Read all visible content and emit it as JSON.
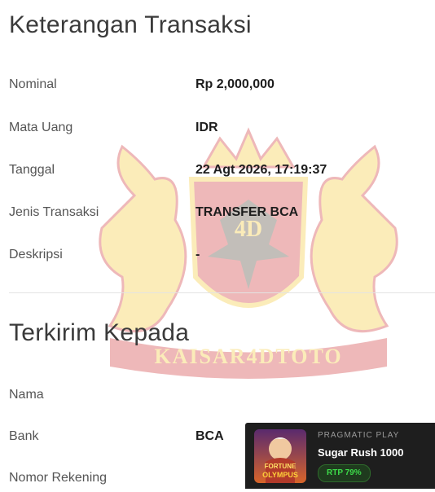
{
  "transaction": {
    "title": "Keterangan Transaksi",
    "rows": [
      {
        "label": "Nominal",
        "value": "Rp 2,000,000"
      },
      {
        "label": "Mata Uang",
        "value": "IDR"
      },
      {
        "label": "Tanggal",
        "value": "22 Agt 2026, 17:19:37"
      },
      {
        "label": "Jenis Transaksi",
        "value": "TRANSFER BCA"
      },
      {
        "label": "Deskripsi",
        "value": "-"
      }
    ]
  },
  "recipient": {
    "title": "Terkirim Kepada",
    "rows": [
      {
        "label": "Nama",
        "value": ""
      },
      {
        "label": "Bank",
        "value": "BCA"
      },
      {
        "label": "Nomor Rekening",
        "value": ""
      }
    ]
  },
  "watermark": {
    "logo_text": "4D",
    "brand_text": "KAISAR4DTOTO"
  },
  "game_popup": {
    "provider": "PRAGMATIC PLAY",
    "name": "Sugar Rush 1000",
    "rtp": "RTP 79%",
    "thumb_text_1": "FORTUNE",
    "thumb_text_2": "OLYMPUS"
  },
  "colors": {
    "accent_gold": "#f2c21b",
    "accent_red": "#c8191b",
    "rtp_green": "#3ddc4a"
  }
}
